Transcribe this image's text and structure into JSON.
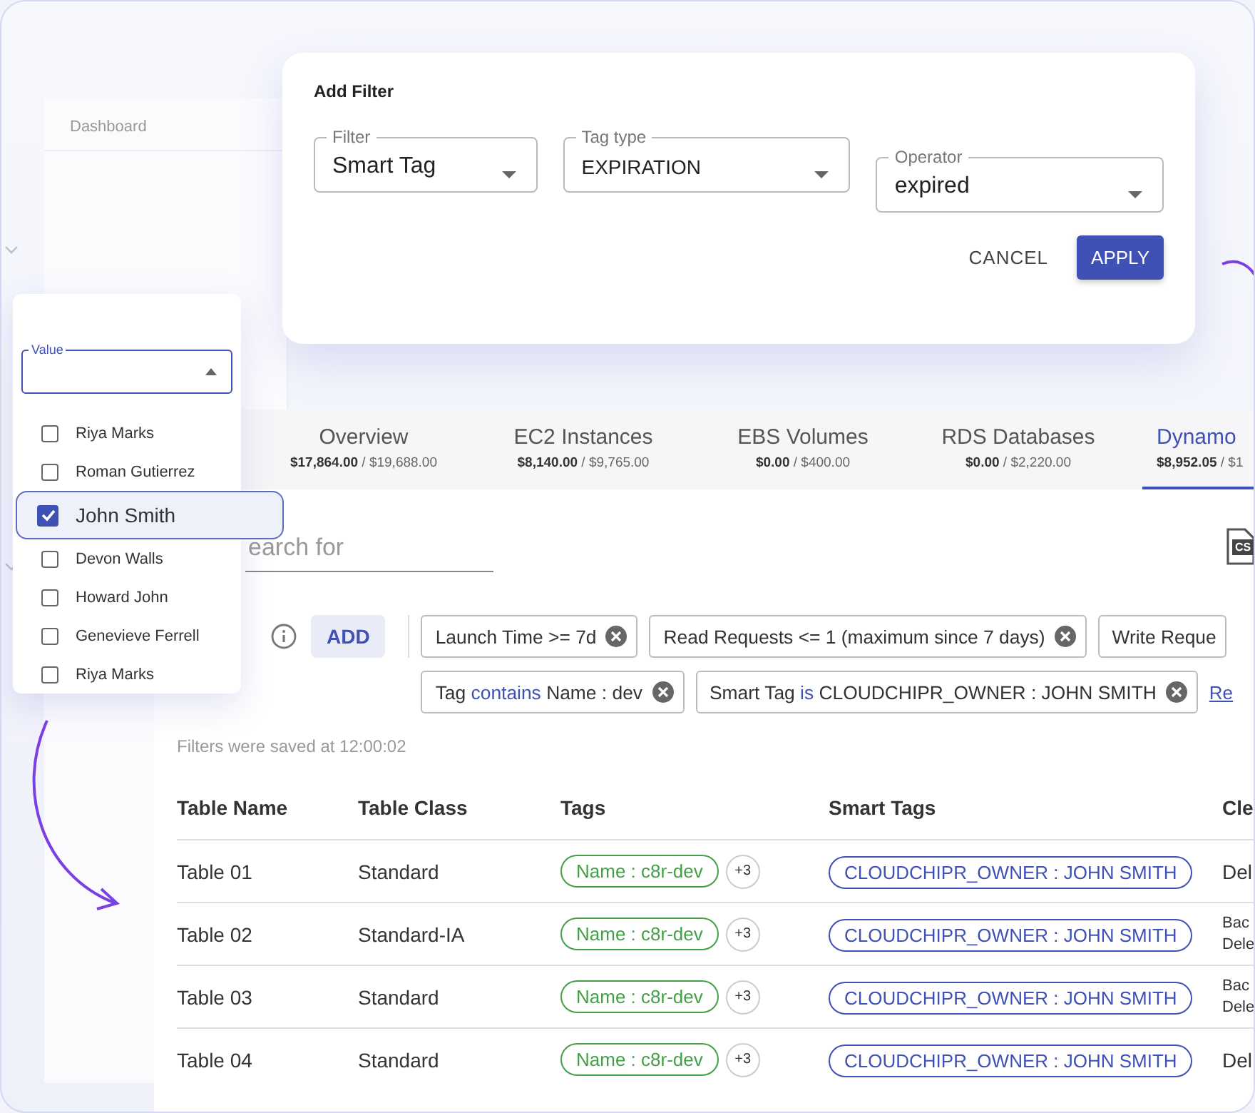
{
  "sidebar": {
    "title": "Dashboard"
  },
  "dialog": {
    "title": "Add Filter",
    "fields": [
      {
        "label": "Filter",
        "value": "Smart Tag"
      },
      {
        "label": "Tag type",
        "value": "EXPIRATION"
      },
      {
        "label": "Operator",
        "value": "expired"
      }
    ],
    "buttons": [
      {
        "label": "CANCEL",
        "kind": "text"
      },
      {
        "label": "APPLY",
        "kind": "primary"
      }
    ]
  },
  "value_dropdown": {
    "label": "Value",
    "options": [
      {
        "label": "Riya Marks",
        "checked": false,
        "selected": false
      },
      {
        "label": "Roman Gutierrez",
        "checked": false,
        "selected": false
      },
      {
        "label": "John Smith",
        "checked": true,
        "selected": true
      },
      {
        "label": "Devon Walls",
        "checked": false,
        "selected": false
      },
      {
        "label": "Howard John",
        "checked": false,
        "selected": false
      },
      {
        "label": "Genevieve Ferrell",
        "checked": false,
        "selected": false
      },
      {
        "label": "Riya Marks",
        "checked": false,
        "selected": false
      }
    ]
  },
  "tabs": [
    {
      "label": "Overview",
      "amount": "$17,864.00",
      "total": " / $19,688.00",
      "selected": false
    },
    {
      "label": "EC2 Instances",
      "amount": "$8,140.00",
      "total": " / $9,765.00",
      "selected": false
    },
    {
      "label": "EBS Volumes",
      "amount": "$0.00",
      "total": " / $400.00",
      "selected": false
    },
    {
      "label": "RDS Databases",
      "amount": "$0.00",
      "total": " / $2,220.00",
      "selected": false
    },
    {
      "label": "Dynamo",
      "amount": "$8,952.05",
      "total": " / $1",
      "selected": true
    }
  ],
  "search": {
    "placeholder": "earch for"
  },
  "csv_button": {
    "label": "CS"
  },
  "add_button": "ADD",
  "filter_rows": [
    [
      {
        "parts": [
          {
            "text": "Launch Time >= 7d",
            "accent": false
          }
        ],
        "removable": true
      },
      {
        "parts": [
          {
            "text": "Read Requests <= 1 (maximum since 7 days)",
            "accent": false
          }
        ],
        "removable": true
      },
      {
        "parts": [
          {
            "text": "Write Reque",
            "accent": false
          }
        ],
        "removable": false
      }
    ],
    [
      {
        "parts": [
          {
            "text": "Tag ",
            "accent": false
          },
          {
            "text": "contains",
            "accent": true
          },
          {
            "text": " Name : dev",
            "accent": false
          }
        ],
        "removable": true
      },
      {
        "parts": [
          {
            "text": "Smart Tag ",
            "accent": false
          },
          {
            "text": "is",
            "accent": true
          },
          {
            "text": " CLOUDCHIPR_OWNER : JOHN SMITH",
            "accent": false
          }
        ],
        "removable": true
      }
    ]
  ],
  "reset_link": "Re",
  "saved_note": "Filters were saved at 12:00:02",
  "table": {
    "columns": [
      "Table Name",
      "Table Class",
      "Tags",
      "Smart Tags",
      "Cle"
    ],
    "rows": [
      {
        "name": "Table 01",
        "class": "Standard",
        "tag": "Name : c8r-dev",
        "more": "+3",
        "smart_tag": "CLOUDCHIPR_OWNER : JOHN SMITH",
        "column_5": [
          "Del"
        ]
      },
      {
        "name": "Table 02",
        "class": "Standard-IA",
        "tag": "Name : c8r-dev",
        "more": "+3",
        "smart_tag": "CLOUDCHIPR_OWNER : JOHN SMITH",
        "column_5": [
          "Bac",
          "Dele"
        ]
      },
      {
        "name": "Table 03",
        "class": "Standard",
        "tag": "Name : c8r-dev",
        "more": "+3",
        "smart_tag": "CLOUDCHIPR_OWNER : JOHN SMITH",
        "column_5": [
          "Bac",
          "Dele"
        ]
      },
      {
        "name": "Table 04",
        "class": "Standard",
        "tag": "Name : c8r-dev",
        "more": "+3",
        "smart_tag": "CLOUDCHIPR_OWNER : JOHN SMITH",
        "column_5": [
          "Del"
        ]
      }
    ]
  }
}
